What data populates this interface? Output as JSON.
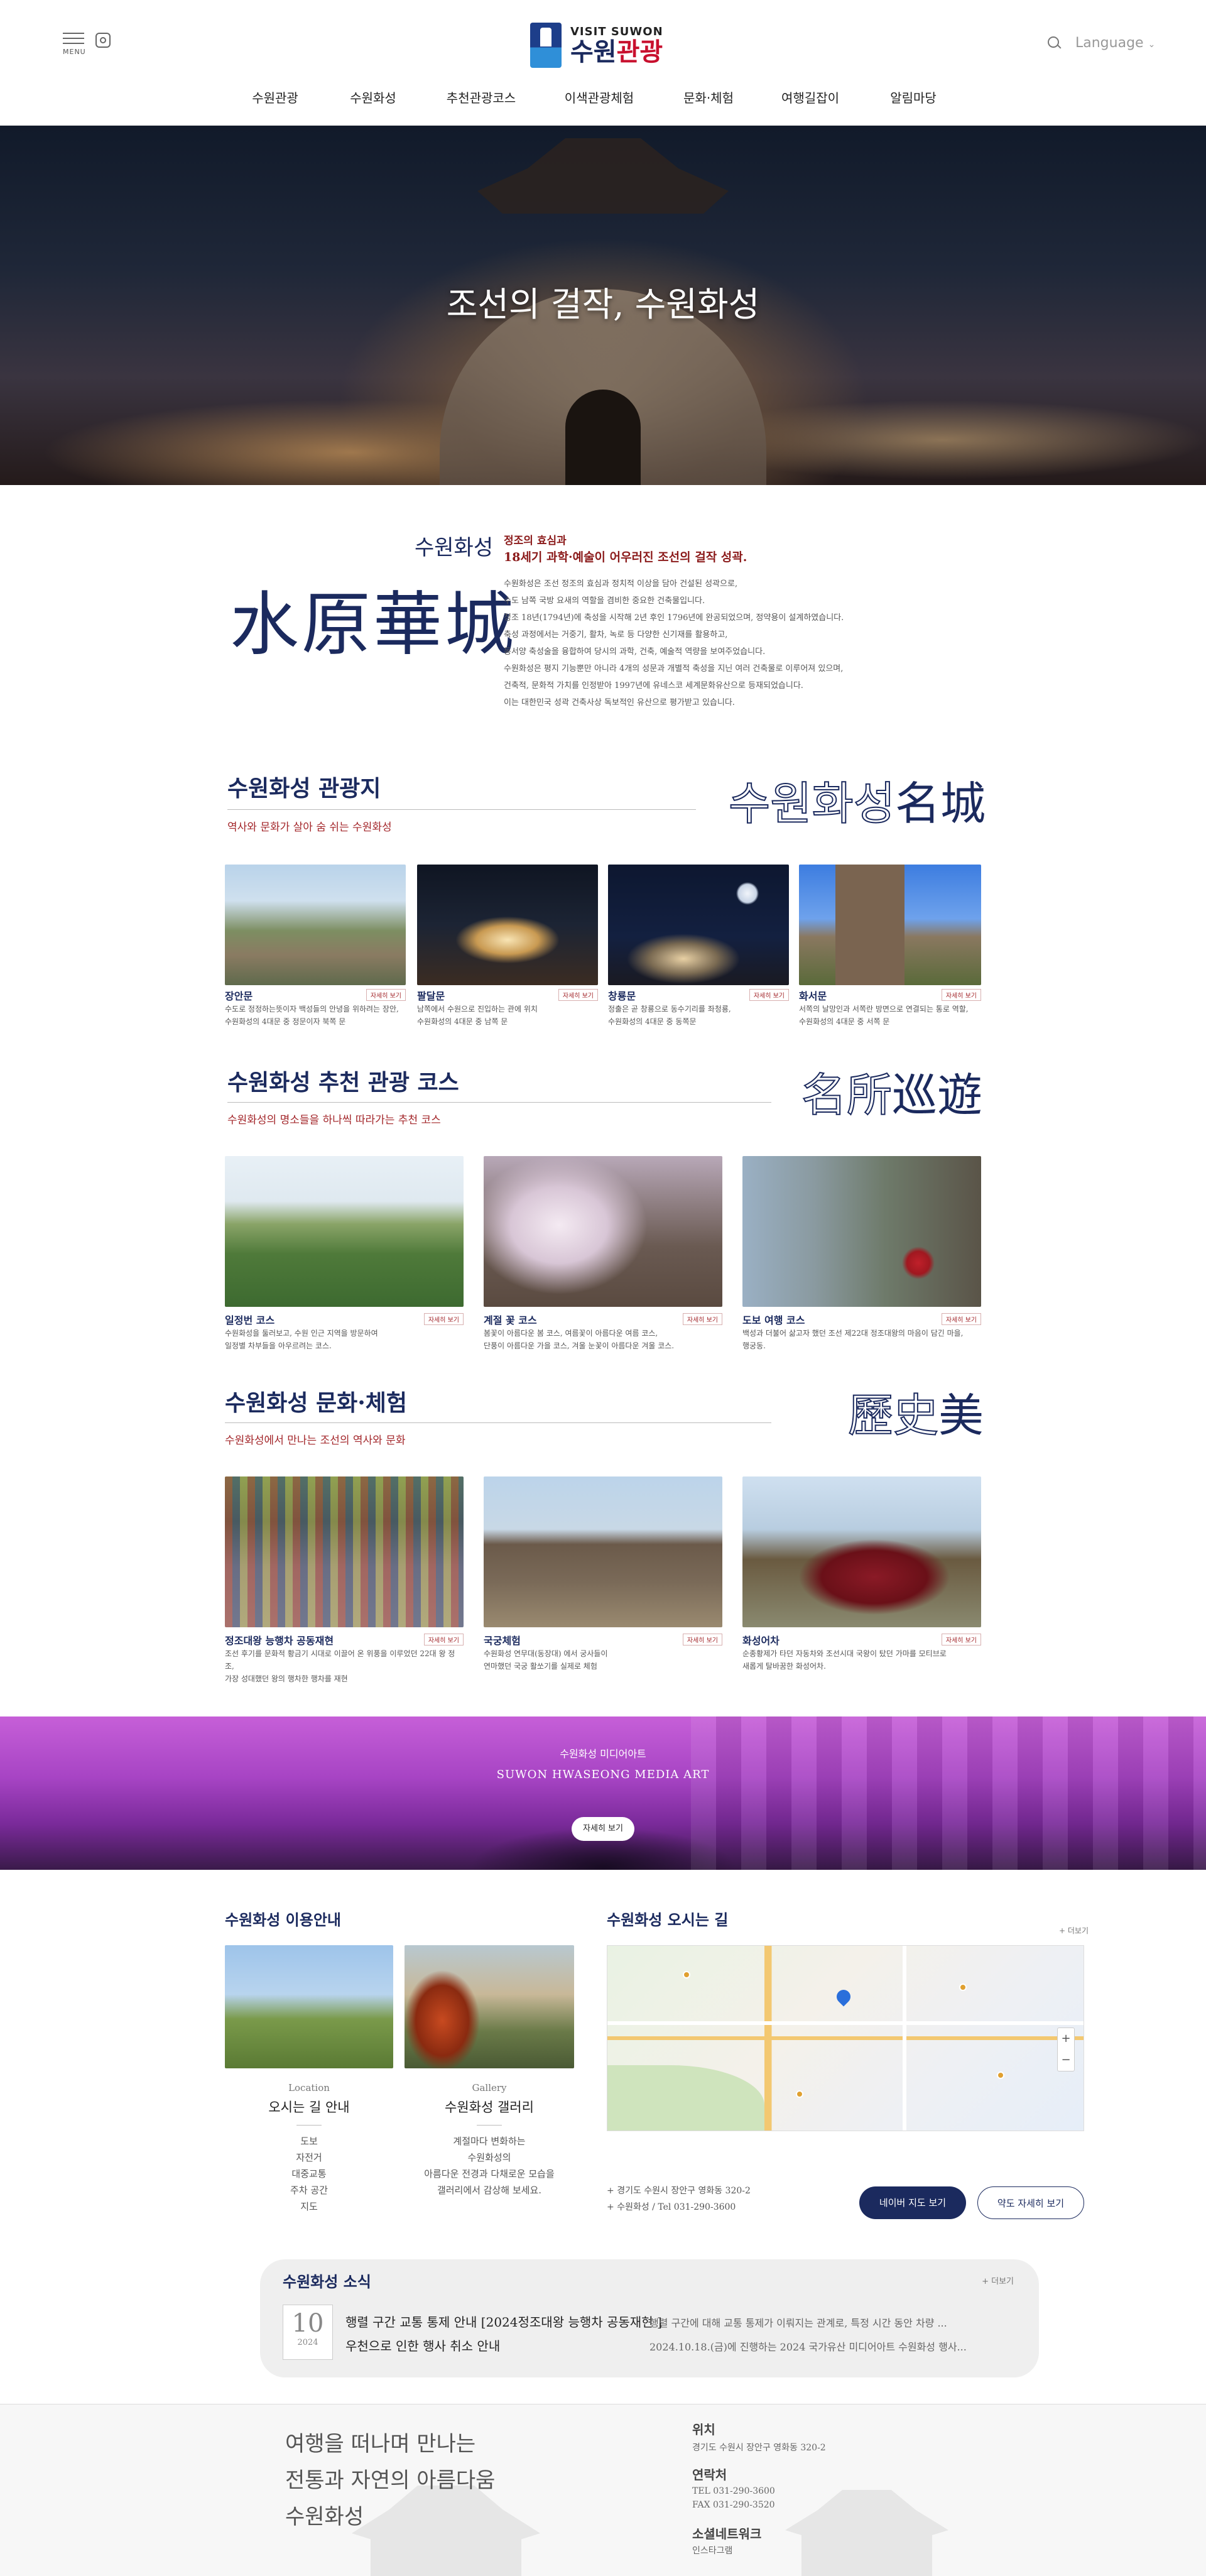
{
  "header": {
    "menu_label": "MENU",
    "logo_small": "VISIT SUWON",
    "logo_big_a": "수원",
    "logo_big_b": "관광",
    "language": "Language",
    "nav": [
      "수원관광",
      "수원화성",
      "추천관광코스",
      "이색관광체험",
      "문화·체험",
      "여행길잡이",
      "알림마당"
    ]
  },
  "hero": {
    "title": "조선의 걸작, 수원화성"
  },
  "intro": {
    "title": "수원화성",
    "hanja": "水原華城",
    "sub1": "정조의 효심과",
    "sub2": "18세기 과학·예술이 어우러진 조선의 걸작 성곽.",
    "body": [
      "수원화성은 조선 정조의 효심과 정치적 이상을 담아 건설된 성곽으로,",
      "수도 남쪽 국방 요새의 역할을 겸비한 중요한 건축물입니다.",
      "정조 18년(1794년)에 축성을 시작해 2년 후인 1796년에 완공되었으며, 정약용이 설계하였습니다.",
      "축성 과정에서는 거중기, 활차, 녹로 등 다양한 신기재를 활용하고,",
      "동서양 축성술을 융합하여 당시의 과학, 건축, 예술적 역량을 보여주었습니다.",
      "수원화성은 평지 기능뿐만 아니라 4개의 성문과 개별적 축성을 지닌 여러 건축물로 이루어져 있으며,",
      "건축적, 문화적 가치를 인정받아 1997년에 유네스코 세계문화유산으로 등재되었습니다.",
      "이는 대한민국 성곽 건축사상 독보적인 유산으로 평가받고 있습니다."
    ]
  },
  "sections": {
    "spots": {
      "title": "수원화성 관광지",
      "sub": "역사와 문화가 살아 숨 쉬는 수원화성",
      "deco_outline": "수원화성",
      "deco_solid": "名城",
      "more": "자세히 보기",
      "cards": [
        {
          "name": "장안문",
          "desc": [
            "수도로 정정하는뜻이자 백성들의 안녕을 위하려는 장안,",
            "수원화성의 4대문 중 정문이자 북쪽 문"
          ],
          "image": "gate-aerial"
        },
        {
          "name": "팔달문",
          "desc": [
            "남쪽에서 수원으로 진입하는 관에 위치",
            "수원화성의 4대문 중 남쪽 문"
          ],
          "image": "gate-night-lit"
        },
        {
          "name": "창룡문",
          "desc": [
            "정출은 곧 창룡으로 동수기리를 좌청룡,",
            "수원화성의 4대문 중 동쪽문"
          ],
          "image": "gate-night-moon"
        },
        {
          "name": "화서문",
          "desc": [
            "서쪽의 날망인과 서쪽란 방면으로 연결되는 통로 역할,",
            "수원화성의 4대문 중 서쪽 문"
          ],
          "image": "west-gate-tower"
        }
      ]
    },
    "courses": {
      "title": "수원화성 추천 관광 코스",
      "sub": "수원화성의 명소들을 하나씩 따라가는 추천 코스",
      "deco_outline": "名所",
      "deco_solid": "巡遊",
      "more": "자세히 보기",
      "cards": [
        {
          "name": "일정번 코스",
          "desc": [
            "수원화성을 둘러보고, 수원 인근 지역을 방문하여",
            "일정별 차부들을 아우르려는 코스."
          ],
          "image": "pavilion-green"
        },
        {
          "name": "계절 꽃 코스",
          "desc": [
            "봄꽃이 아름다운 봄 코스, 여름꽃이 아름다운 여름 코스,",
            "단풍이 아름다운 가을 코스, 겨울 눈꽃이 아름다운 겨울 코스."
          ],
          "image": "cherry-blossom"
        },
        {
          "name": "도보 여행 코스",
          "desc": [
            "백성과 더불어 삶고자 했던 조선 제22대 정조대왕의 마음이 담긴 마을,",
            "행궁동."
          ],
          "image": "village-wall"
        }
      ]
    },
    "culture": {
      "title": "수원화성 문화·체험",
      "sub": "수원화성에서 만나는 조선의 역사와 문화",
      "deco_outline": "歷史",
      "deco_solid": "美",
      "more": "자세히 보기",
      "cards": [
        {
          "name": "정조대왕 능행차 공동재현",
          "desc": [
            "조선 후기를 문화적 황금기 시대로 이끌어 온 위풍을 이루었던 22대 왕 정조,",
            "가장 성대했던 왕의 행차한 행차를 재현"
          ],
          "image": "parade"
        },
        {
          "name": "국궁체험",
          "desc": [
            "수원화성 연무대(동장대) 에서 궁사들이",
            "연마했던 국궁 활쏘기를 실제로 체험"
          ],
          "image": "archery"
        },
        {
          "name": "화성어차",
          "desc": [
            "순종황제가 타던 자동차와 조선시대 국왕이 탔던 가마를 모티브로",
            "새롭게 탈바꿈한 화성어차."
          ],
          "image": "royal-car"
        }
      ]
    }
  },
  "media": {
    "t1": "수원화성 미디어아트",
    "t2": "SUWON HWASEONG MEDIA ART",
    "button": "자세히 보기"
  },
  "guide": {
    "title": "수원화성 이용안내",
    "cards": [
      {
        "en": "Location",
        "ko": "오시는 길 안내",
        "items": [
          "도보",
          "자전거",
          "대중교통",
          "주차 공간",
          "지도"
        ]
      },
      {
        "en": "Gallery",
        "ko": "수원화성 갤러리",
        "items": [
          "계절마다 변화하는",
          "수원화성의",
          "아름다운 전경과 다채로운 모습을",
          "갤러리에서 감상해 보세요."
        ]
      }
    ]
  },
  "location": {
    "title": "수원화성 오시는 길",
    "more": "+ 더보기",
    "addr1": "경기도 수원시 장안구 영화동 320-2",
    "addr2": "수원화성 / Tel 031-290-3600",
    "btn_naver": "네이버 지도 보기",
    "btn_detail": "약도 자세히 보기"
  },
  "news": {
    "title": "수원화성 소식",
    "more": "+ 더보기",
    "day": "10",
    "year": "2024",
    "head1": "행렬 구간 교통 통제 안내 [2024정조대왕 능행차 공동재현 ]",
    "head2": "우천으로 인한 행사 취소 안내",
    "snip1": "행렬 구간에 대해 교통 통제가 이뤄지는 관계로, 특정 시간 동안 차량 ...",
    "snip2": "2024.10.18.(금)에 진행하는 2024 국가유산 미디어아트 수원화성 행사..."
  },
  "footer": {
    "tagline": [
      "여행을 떠나며 만나는",
      "전통과 자연의 아름다움",
      "수원화성"
    ],
    "loc_h": "위치",
    "loc_t": "경기도 수원시 장안구 영화동 320-2",
    "contact_h": "연락처",
    "tel": "TEL    031-290-3600",
    "fax": "FAX    031-290-3520",
    "social_h": "소셜네트워크",
    "social_t": "인스타그램"
  }
}
